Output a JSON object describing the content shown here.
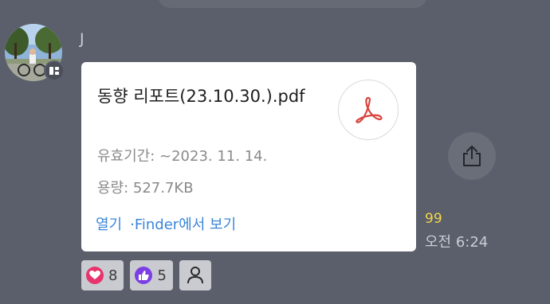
{
  "sender": {
    "name": "J"
  },
  "file": {
    "name": "동향 리포트(23.10.30.).pdf",
    "validity": "유효기간: ~2023. 11. 14.",
    "size": "용량: 527.7KB",
    "icon": "pdf-icon"
  },
  "actions": {
    "open": "열기",
    "finder": "·Finder에서 보기"
  },
  "status": {
    "unread_count": "99",
    "time": "오전 6:24"
  },
  "reactions": [
    {
      "icon": "heart-icon",
      "count": "8",
      "color": "#e8336b"
    },
    {
      "icon": "thumbs-up-icon",
      "count": "5",
      "color": "#7b3fe4"
    },
    {
      "icon": "person-icon",
      "count": ""
    }
  ],
  "colors": {
    "background": "#5b5f6b",
    "link": "#3a86d8",
    "unread": "#f3d547",
    "pdf_red": "#d9443f"
  }
}
